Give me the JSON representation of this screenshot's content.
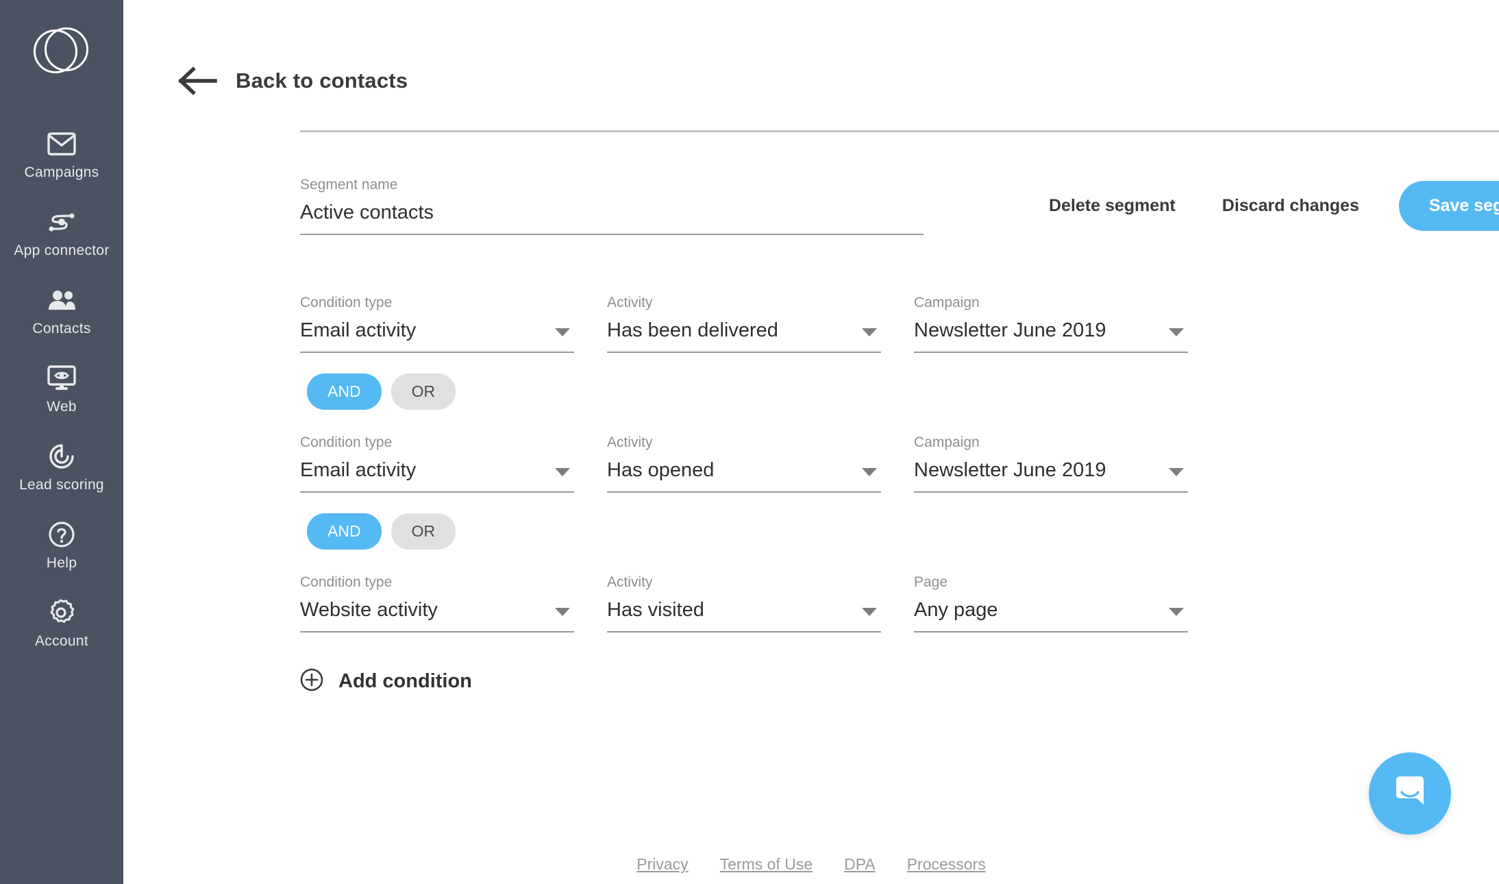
{
  "sidebar": {
    "logo_name": "brand-logo",
    "bg_color": "#4b5261",
    "items": [
      {
        "label": "Campaigns",
        "icon": "envelope-icon"
      },
      {
        "label": "App connector",
        "icon": "connector-icon"
      },
      {
        "label": "Contacts",
        "icon": "people-icon"
      },
      {
        "label": "Web",
        "icon": "monitor-eye-icon"
      },
      {
        "label": "Lead scoring",
        "icon": "target-icon"
      },
      {
        "label": "Help",
        "icon": "question-circle-icon"
      },
      {
        "label": "Account",
        "icon": "gear-icon"
      }
    ]
  },
  "header": {
    "back_label": "Back to contacts",
    "back_icon": "arrow-left-icon"
  },
  "segment": {
    "name_label": "Segment name",
    "name_value": "Active contacts",
    "name_placeholder": "Segment name"
  },
  "toolbar": {
    "delete_label": "Delete segment",
    "discard_label": "Discard changes",
    "save_label": "Save segment",
    "accent_color": "#55b9f3"
  },
  "conditions": [
    {
      "type_label": "Condition type",
      "type_value": "Email activity",
      "activity_label": "Activity",
      "activity_value": "Has been delivered",
      "target_label": "Campaign",
      "target_value": "Newsletter June 2019",
      "delete_icon": "trash-icon"
    },
    {
      "type_label": "Condition type",
      "type_value": "Email activity",
      "activity_label": "Activity",
      "activity_value": "Has opened",
      "target_label": "Campaign",
      "target_value": "Newsletter June 2019",
      "delete_icon": "trash-icon"
    },
    {
      "type_label": "Condition type",
      "type_value": "Website activity",
      "activity_label": "Activity",
      "activity_value": "Has visited",
      "target_label": "Page",
      "target_value": "Any page",
      "delete_icon": "trash-icon"
    }
  ],
  "logic": [
    {
      "and_label": "AND",
      "or_label": "OR",
      "selected": "AND"
    },
    {
      "and_label": "AND",
      "or_label": "OR",
      "selected": "AND"
    }
  ],
  "add_condition": {
    "label": "Add condition",
    "icon": "plus-circle-icon"
  },
  "footer": {
    "links": [
      {
        "label": "Privacy"
      },
      {
        "label": "Terms of Use"
      },
      {
        "label": "DPA"
      },
      {
        "label": "Processors"
      }
    ]
  },
  "chat": {
    "icon": "chat-smile-icon",
    "color": "#55b9f3"
  }
}
